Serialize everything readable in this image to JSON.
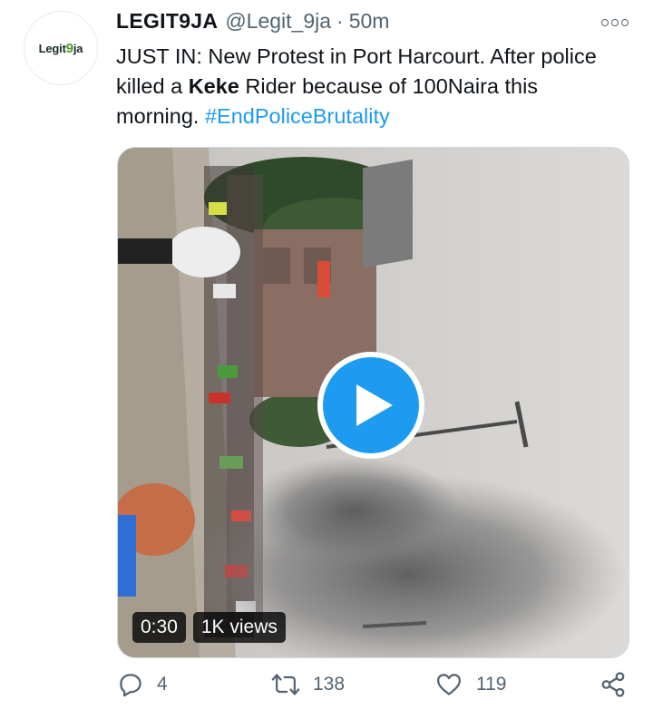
{
  "tweet": {
    "avatar_text_a": "Legit",
    "avatar_text_b": "9",
    "avatar_text_c": "ja",
    "display_name": "LEGIT9JA",
    "handle": "@Legit_9ja",
    "separator": "·",
    "time": "50m",
    "text_part1": "JUST IN: New Protest in Port Harcourt. After police killed a ",
    "text_bold": "Keke",
    "text_part2": " Rider because of 100Naira this morning. ",
    "hashtag": "#EndPoliceBrutality"
  },
  "media": {
    "duration": "0:30",
    "views": "1K views"
  },
  "actions": {
    "replies": "4",
    "retweets": "138",
    "likes": "119"
  },
  "colors": {
    "accent": "#1d9bf0",
    "secondary_text": "#536471"
  },
  "icons": [
    "more-icon",
    "play-icon",
    "reply-icon",
    "retweet-icon",
    "like-icon",
    "share-icon"
  ]
}
